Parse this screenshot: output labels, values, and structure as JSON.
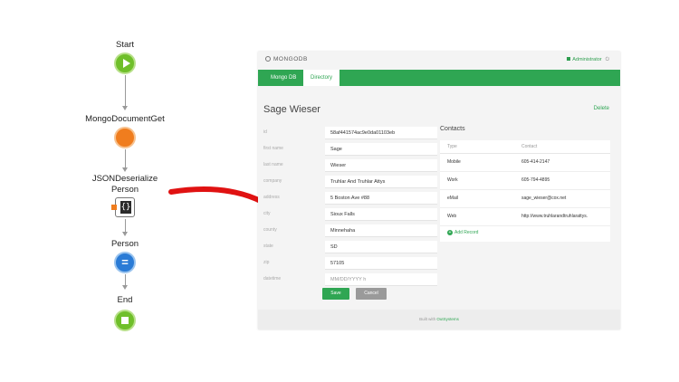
{
  "flow": {
    "nodes": [
      {
        "label": "Start"
      },
      {
        "label": "MongoDocumentGet"
      },
      {
        "label": "JSONDeserialize\nPerson",
        "line1": "JSONDeserialize",
        "line2": "Person",
        "icon_text": "{}"
      },
      {
        "label": "Person",
        "icon_text": "="
      },
      {
        "label": "End"
      }
    ]
  },
  "app": {
    "logo": "MONGODB",
    "user": "Administrator",
    "tabs": [
      "Mongo DB",
      "Directory"
    ],
    "active_tab": "Directory",
    "title": "Sage Wieser",
    "delete_label": "Delete",
    "fields": [
      {
        "label": "id",
        "value": "58af441574ac9e0da01103eb"
      },
      {
        "label": "first name",
        "value": "Sage"
      },
      {
        "label": "last name",
        "value": "Wieser"
      },
      {
        "label": "company",
        "value": "Truhlar And Truhlar Attys"
      },
      {
        "label": "address",
        "value": "5 Boston Ave #88"
      },
      {
        "label": "city",
        "value": "Sioux Falls"
      },
      {
        "label": "county",
        "value": "Minnehaha"
      },
      {
        "label": "state",
        "value": "SD"
      },
      {
        "label": "zip",
        "value": "57105"
      },
      {
        "label": "datetime",
        "placeholder": "MM/DD/YYYY h"
      }
    ],
    "save_label": "Save",
    "cancel_label": "Cancel",
    "contacts": {
      "title": "Contacts",
      "headers": [
        "Type",
        "Contact"
      ],
      "rows": [
        [
          "Mobile",
          "605-414-2147"
        ],
        [
          "Work",
          "605-794-4895"
        ],
        [
          "eMail",
          "sage_wieser@cox.net"
        ],
        [
          "Web",
          "http://www.truhlarandtruhlarattys."
        ]
      ],
      "add_label": "Add Record"
    },
    "footer_prefix": "Built with",
    "footer_brand": "OutSystems"
  },
  "colors": {
    "accent": "#2fa653",
    "start_end": "#6fbf2a",
    "mongo": "#f07d1e",
    "assign": "#2a7bd6",
    "arrow": "#e01212"
  }
}
